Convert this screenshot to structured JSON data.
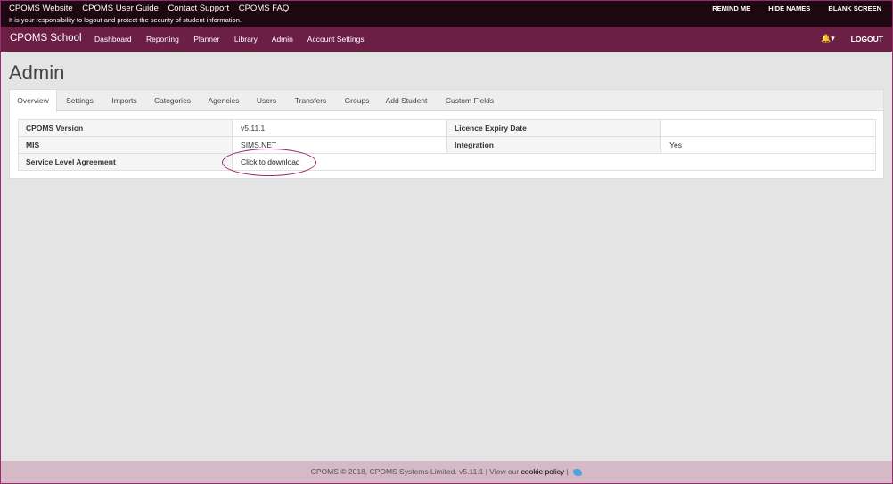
{
  "topbar": {
    "links": [
      "CPOMS Website",
      "CPOMS User Guide",
      "Contact Support",
      "CPOMS FAQ"
    ],
    "notice": "It is your responsibility to logout and protect the security of student information.",
    "right": [
      "REMIND ME",
      "HIDE NAMES",
      "BLANK SCREEN"
    ]
  },
  "navbar": {
    "brand": "CPOMS School",
    "items": [
      "Dashboard",
      "Reporting",
      "Planner",
      "Library",
      "Admin",
      "Account Settings"
    ],
    "logout": "LOGOUT"
  },
  "page": {
    "title": "Admin"
  },
  "tabs": [
    "Overview",
    "Settings",
    "Imports",
    "Categories",
    "Agencies",
    "Users",
    "Transfers",
    "Groups",
    "Add Student",
    "Custom Fields"
  ],
  "active_tab": "Overview",
  "info": {
    "cpoms_version_label": "CPOMS Version",
    "cpoms_version_value": "v5.11.1",
    "licence_label": "Licence Expiry Date",
    "licence_value": "",
    "mis_label": "MIS",
    "mis_value": "SIMS.NET",
    "integration_label": "Integration",
    "integration_value": "Yes",
    "sla_label": "Service Level Agreement",
    "sla_link": "Click to download"
  },
  "footer": {
    "text": "CPOMS © 2018, CPOMS Systems Limited. v5.11.1 | View our",
    "link": "cookie policy",
    "sep": "|"
  },
  "colors": {
    "topbar": "#1d0812",
    "navbar": "#6b1f45",
    "footer": "#d6b9c6",
    "highlight": "#9b2b6f",
    "twitter": "#4ba3e0"
  },
  "icons": {
    "bell": "bell-icon",
    "twitter": "twitter-icon"
  }
}
